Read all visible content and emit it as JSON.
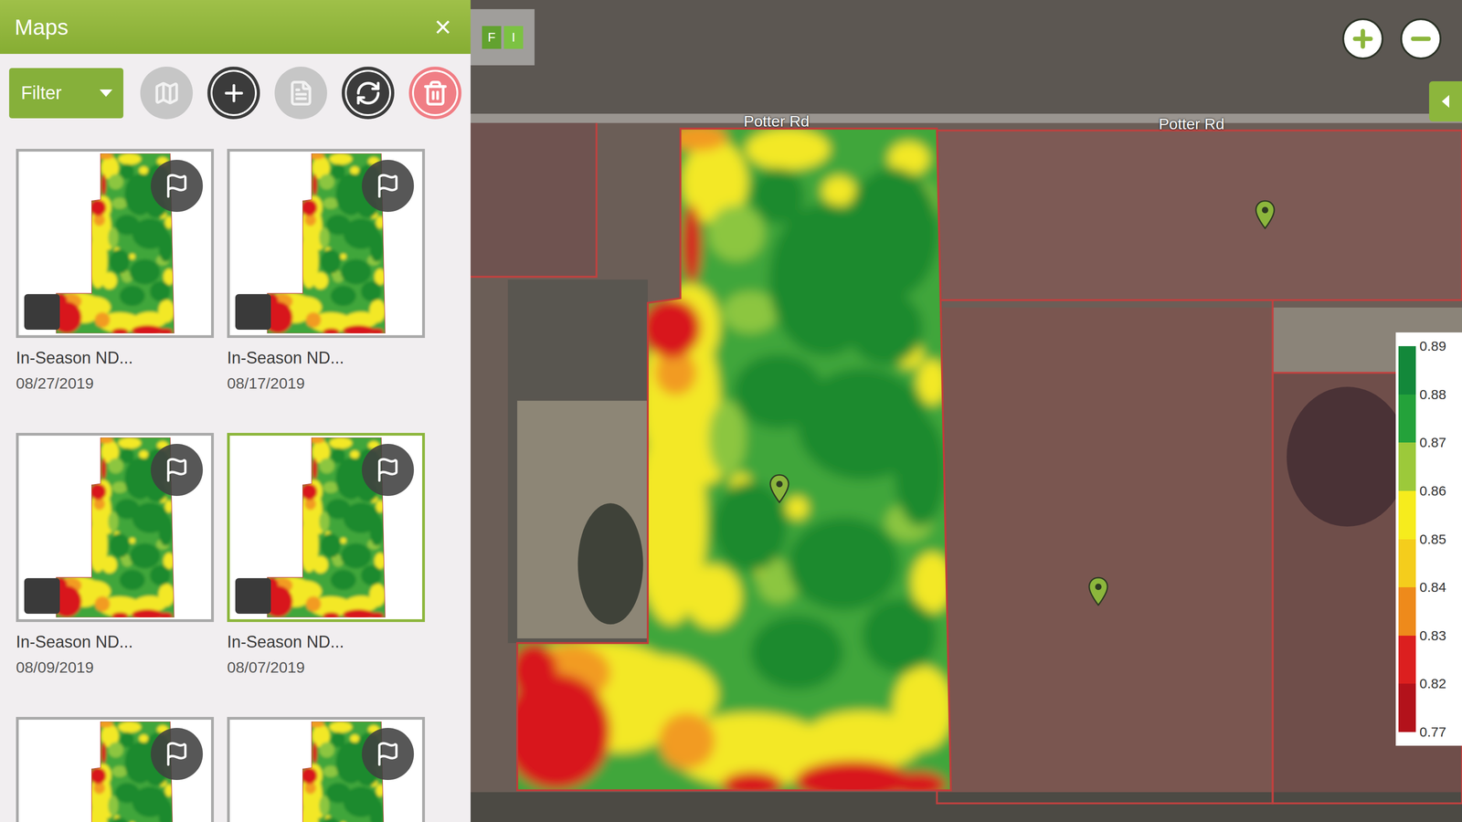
{
  "panel": {
    "title": "Maps",
    "close": "×"
  },
  "toolbar": {
    "filter": {
      "label": "Filter"
    },
    "buttons": [
      {
        "disabled": true
      },
      {
        "disabled": false
      },
      {
        "disabled": true
      },
      {
        "disabled": false
      },
      {
        "disabled": false
      }
    ]
  },
  "maps": [
    {
      "title": "In-Season ND...",
      "date": "08/27/2019",
      "selected": false
    },
    {
      "title": "In-Season ND...",
      "date": "08/17/2019",
      "selected": false
    },
    {
      "title": "In-Season ND...",
      "date": "08/09/2019",
      "selected": false
    },
    {
      "title": "In-Season ND...",
      "date": "08/07/2019",
      "selected": true
    },
    {
      "selected": false
    },
    {
      "selected": false
    }
  ],
  "layer_toggle": [
    {
      "label": "F",
      "selected": false
    },
    {
      "label": "I",
      "selected": true
    }
  ],
  "map": {
    "roads": [
      "Potter Rd",
      "Potter Rd"
    ]
  },
  "legend": {
    "ticks": [
      "0.89",
      "0.88",
      "0.87",
      "0.86",
      "0.85",
      "0.84",
      "0.83",
      "0.82",
      "0.77"
    ],
    "bands": [
      {
        "color": "#13883a"
      },
      {
        "color": "#24a23a"
      },
      {
        "color": "#9cc93a"
      },
      {
        "color": "#f6ec1d"
      },
      {
        "color": "#f4cd1c"
      },
      {
        "color": "#ee8a1b"
      },
      {
        "color": "#dc1f1f"
      },
      {
        "color": "#b3121b"
      }
    ]
  }
}
